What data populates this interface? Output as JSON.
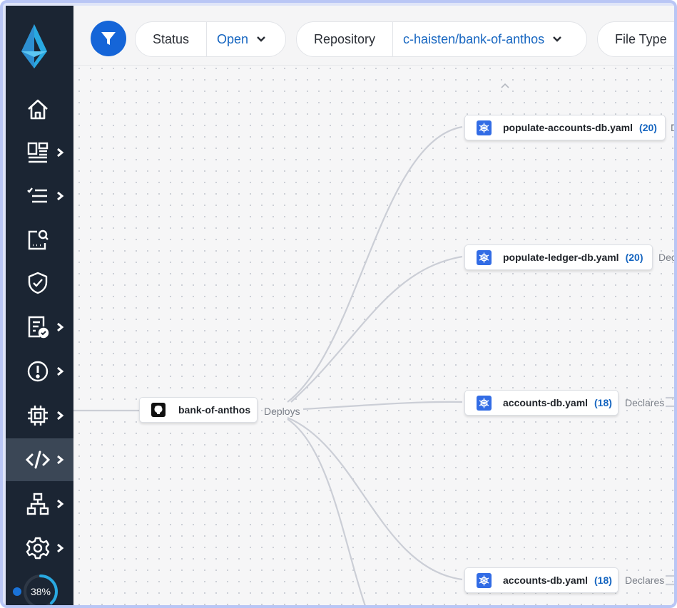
{
  "sidebar": {
    "items": [
      {
        "icon": "home-icon",
        "has_submenu": false
      },
      {
        "icon": "dashboard-icon",
        "has_submenu": true
      },
      {
        "icon": "checklist-icon",
        "has_submenu": true
      },
      {
        "icon": "inventory-search-icon",
        "has_submenu": false
      },
      {
        "icon": "shield-check-icon",
        "has_submenu": false
      },
      {
        "icon": "report-check-icon",
        "has_submenu": true
      },
      {
        "icon": "alert-circle-icon",
        "has_submenu": true
      },
      {
        "icon": "chip-icon",
        "has_submenu": true
      },
      {
        "icon": "code-icon",
        "has_submenu": true,
        "active": true
      },
      {
        "icon": "network-icon",
        "has_submenu": true
      },
      {
        "icon": "gear-icon",
        "has_submenu": true
      }
    ],
    "progress": {
      "label": "38%",
      "value": 0.38
    }
  },
  "filters": {
    "status": {
      "label": "Status",
      "value": "Open"
    },
    "repository": {
      "label": "Repository",
      "value": "c-haisten/bank-of-anthos"
    },
    "file_type": {
      "label": "File Type"
    }
  },
  "graph": {
    "root": {
      "name": "bank-of-anthos",
      "edge_label": "Deploys"
    },
    "nodes": [
      {
        "name": "populate-accounts-db.yaml",
        "count": "(20)",
        "edge_label": "De"
      },
      {
        "name": "populate-ledger-db.yaml",
        "count": "(20)",
        "edge_label": "Dec"
      },
      {
        "name": "accounts-db.yaml",
        "count": "(18)",
        "edge_label": "Declares"
      },
      {
        "name": "accounts-db.yaml",
        "count": "(18)",
        "edge_label": "Declares"
      }
    ]
  },
  "colors": {
    "accent": "#1565c0",
    "sidebar": "#1b2533",
    "link": "#c9ccd4"
  }
}
